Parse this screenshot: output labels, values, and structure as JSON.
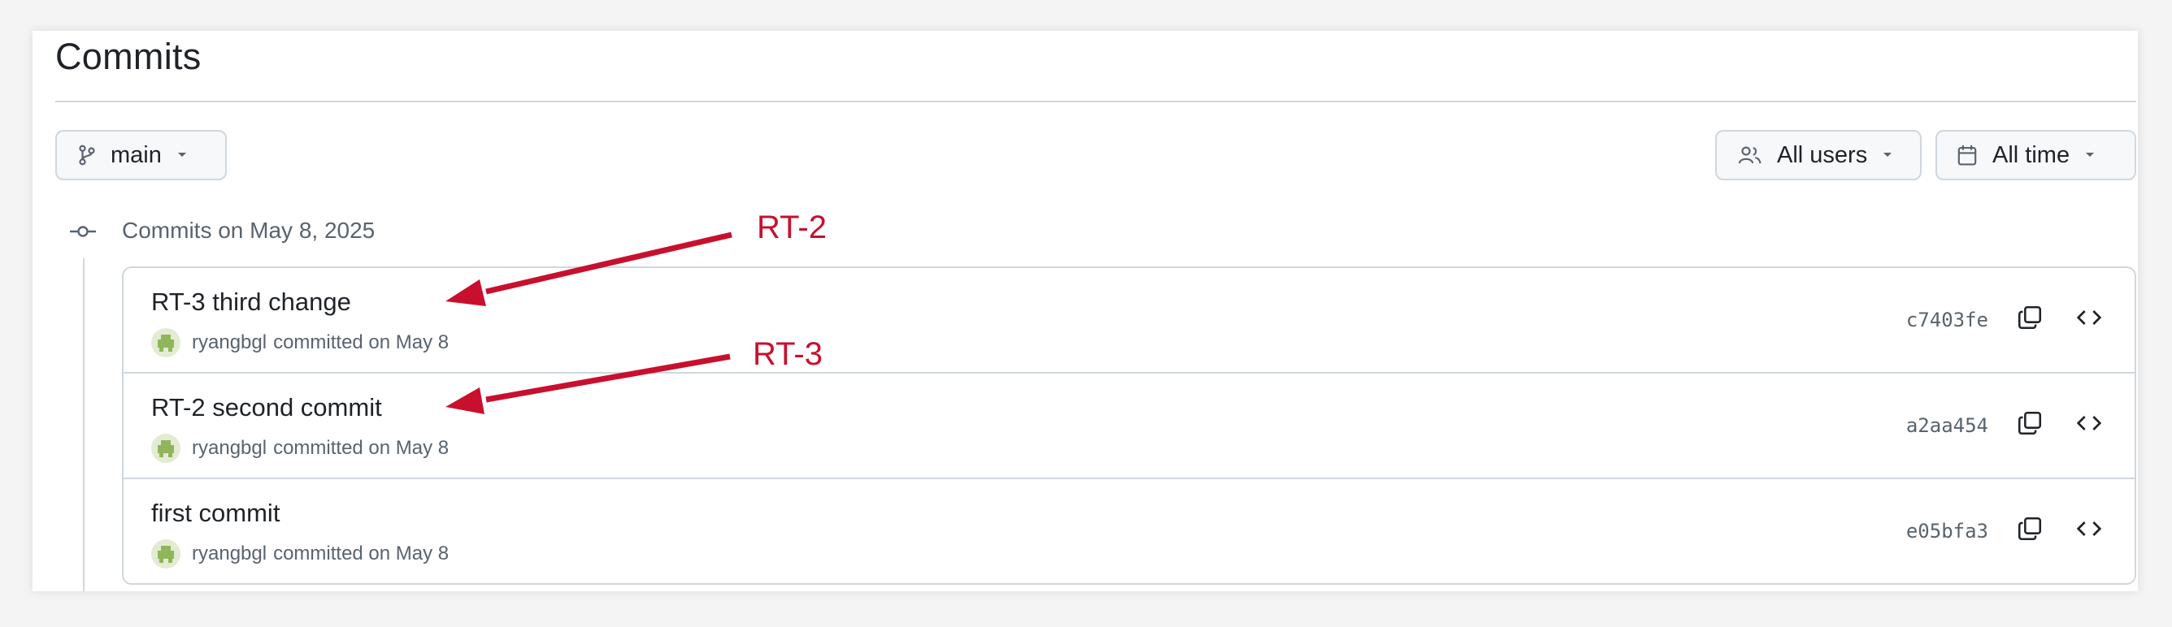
{
  "page": {
    "title": "Commits"
  },
  "toolbar": {
    "branch_label": "main",
    "users_label": "All users",
    "time_label": "All time"
  },
  "group": {
    "heading": "Commits on May 8, 2025"
  },
  "commits": [
    {
      "title": "RT-3 third change",
      "author": "ryangbgl",
      "verb": "committed on May 8",
      "sha": "c7403fe"
    },
    {
      "title": "RT-2 second commit",
      "author": "ryangbgl",
      "verb": "committed on May 8",
      "sha": "a2aa454"
    },
    {
      "title": "first commit",
      "author": "ryangbgl",
      "verb": "committed on May 8",
      "sha": "e05bfa3"
    }
  ],
  "annotations": [
    {
      "label": "RT-2"
    },
    {
      "label": "RT-3"
    }
  ],
  "colors": {
    "annotation": "#c8102e",
    "border": "#d0d7de",
    "muted": "#59636e"
  }
}
